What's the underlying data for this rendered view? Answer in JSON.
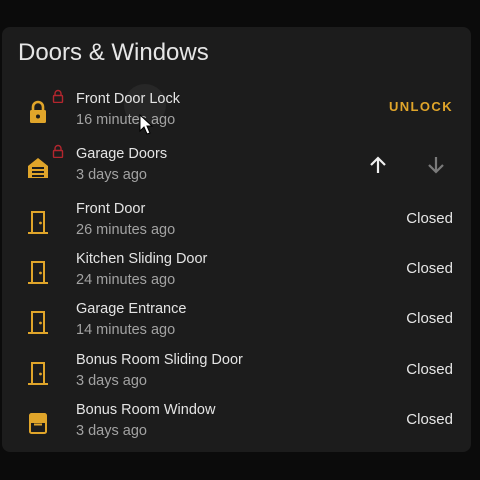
{
  "card": {
    "title": "Doors & Windows"
  },
  "rows": [
    {
      "name": "Front Door Lock",
      "time": "16 minutes ago",
      "action": "UNLOCK",
      "icon": "lock-icon",
      "badge": "lock-badge-icon"
    },
    {
      "name": "Garage Doors",
      "time": "3 days ago",
      "icon": "garage-icon",
      "badge": "lock-badge-icon",
      "controls": [
        "arrow-up-icon",
        "arrow-down-icon"
      ]
    },
    {
      "name": "Front Door",
      "time": "26 minutes ago",
      "state": "Closed",
      "icon": "door-closed-icon"
    },
    {
      "name": "Kitchen Sliding Door",
      "time": "24 minutes ago",
      "state": "Closed",
      "icon": "door-closed-icon"
    },
    {
      "name": "Garage Entrance",
      "time": "14 minutes ago",
      "state": "Closed",
      "icon": "door-closed-icon"
    },
    {
      "name": "Bonus Room Sliding Door",
      "time": "3 days ago",
      "state": "Closed",
      "icon": "door-closed-icon"
    },
    {
      "name": "Bonus Room Window",
      "time": "3 days ago",
      "state": "Closed",
      "icon": "window-closed-icon"
    }
  ],
  "colors": {
    "accent": "#e0a52a",
    "badge": "#b3262e",
    "background": "#1c1c1c",
    "text": "#e6e6e6",
    "secondary_text": "#a2a2a2"
  }
}
